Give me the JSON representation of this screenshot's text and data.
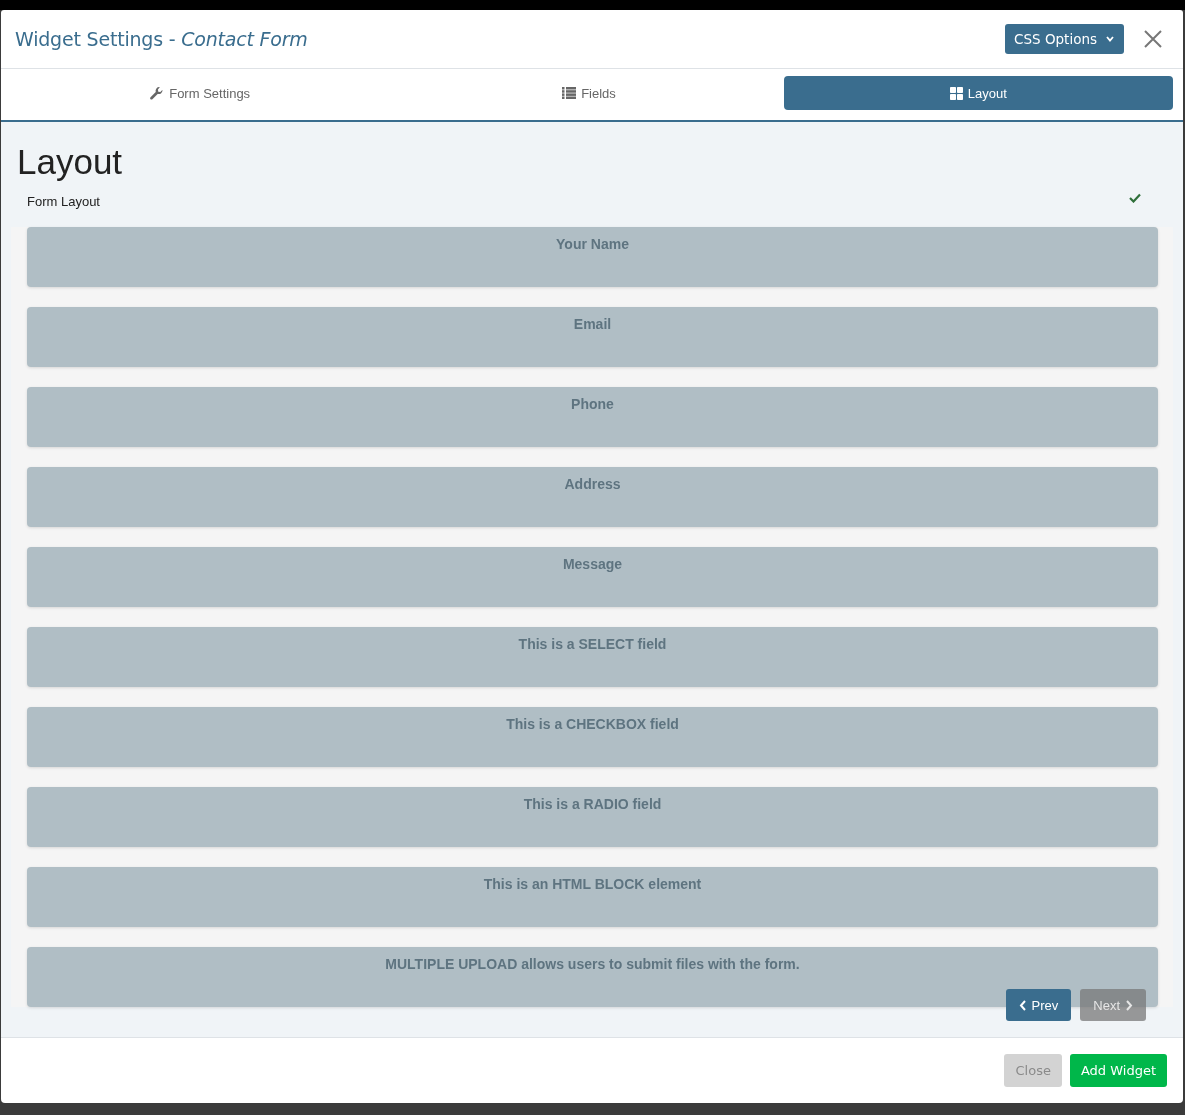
{
  "window": {
    "title": "Widget Settings - *Contact Form*",
    "options_button": "CSS Options"
  },
  "tabs": [
    {
      "label": "Form Settings",
      "selected": false
    },
    {
      "label": "Fields",
      "selected": false
    },
    {
      "label": "Layout",
      "selected": true
    }
  ],
  "section": {
    "heading": "Layout",
    "label": "Form Layout",
    "valid": true
  },
  "fields": [
    "Your Name",
    "Email",
    "Phone",
    "Address",
    "Message",
    "This is a SELECT field",
    "This is a CHECKBOX field",
    "This is a RADIO field",
    "This is an HTML BLOCK element",
    "MULTIPLE UPLOAD allows users to submit files with the form."
  ],
  "pager": [
    {
      "kind": "prev",
      "label": "Prev",
      "disabled": false
    },
    {
      "kind": "next",
      "label": "Next",
      "disabled": true
    }
  ],
  "footer_buttons": [
    {
      "kind": "secondary",
      "label": "Close"
    },
    {
      "kind": "success",
      "label": "Add Widget"
    }
  ]
}
